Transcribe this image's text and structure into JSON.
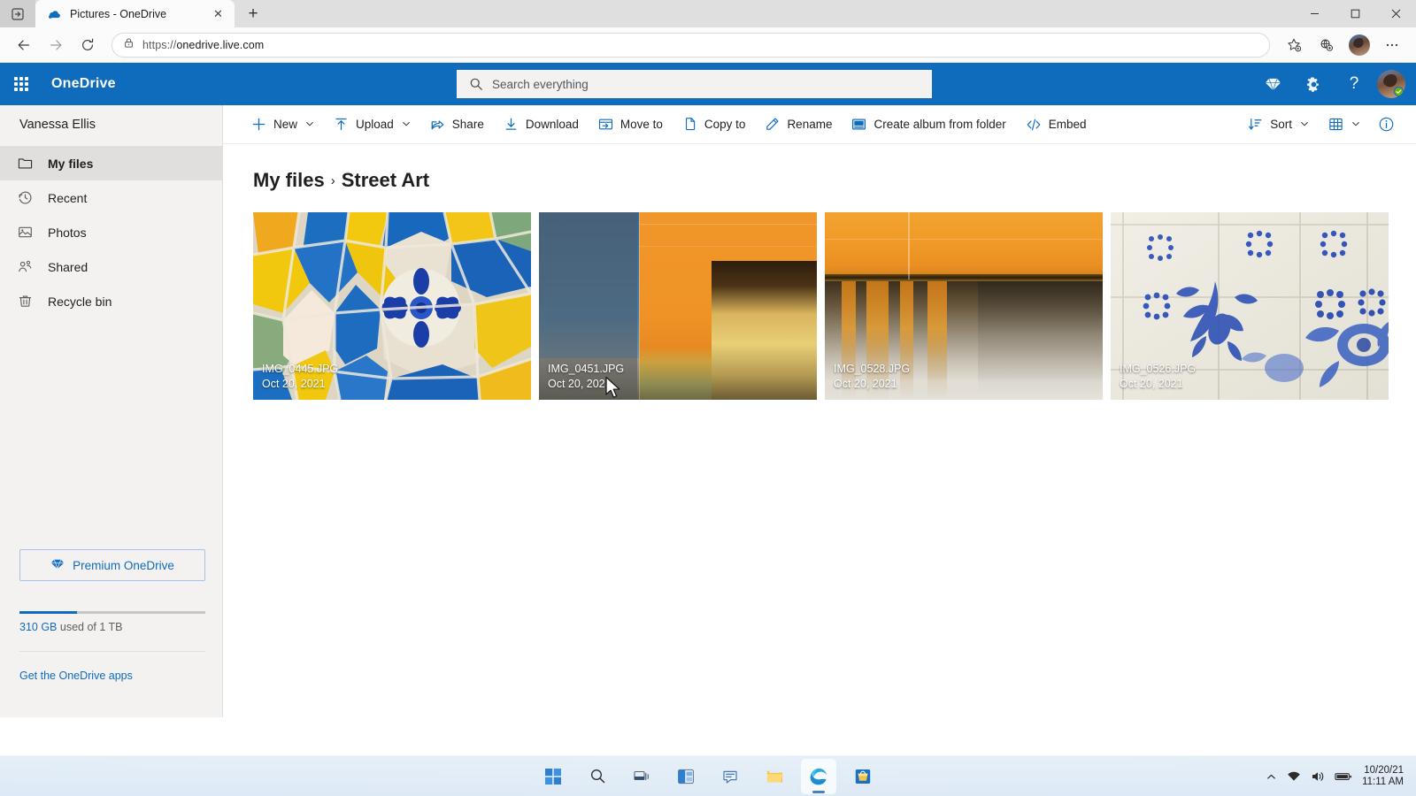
{
  "browser": {
    "tab": {
      "title": "Pictures - OneDrive",
      "favicon": "onedrive-cloud-icon",
      "close_label": "✕"
    },
    "new_tab_label": "+",
    "window_controls": {
      "minimize": "─",
      "maximize": "☐",
      "close": "✕"
    },
    "nav": {
      "back": "←",
      "forward": "→",
      "reload": "↻"
    },
    "address": {
      "scheme": "https://",
      "host": "onedrive.live.com",
      "full": "https://onedrive.live.com",
      "lock_icon": "lock-icon"
    },
    "right_icons": [
      "favorites-star-icon",
      "collections-icon",
      "profile-avatar",
      "settings-more-icon"
    ]
  },
  "suitebar": {
    "waffle_label": "app-launcher",
    "brand": "OneDrive",
    "search": {
      "placeholder": "Search everything",
      "value": ""
    },
    "icons": [
      "premium-diamond-icon",
      "settings-gear-icon",
      "help-question-icon"
    ],
    "help_glyph": "?",
    "avatar_name": "account-avatar"
  },
  "sidebar": {
    "user": "Vanessa Ellis",
    "items": [
      {
        "label": "My files",
        "icon": "folder-icon",
        "active": true
      },
      {
        "label": "Recent",
        "icon": "clock-history-icon",
        "active": false
      },
      {
        "label": "Photos",
        "icon": "photo-icon",
        "active": false
      },
      {
        "label": "Shared",
        "icon": "people-shared-icon",
        "active": false
      },
      {
        "label": "Recycle bin",
        "icon": "trash-bin-icon",
        "active": false
      }
    ],
    "premium_button": "Premium OneDrive",
    "premium_icon": "diamond-icon",
    "quota": {
      "used_text": "310 GB",
      "rest_text": " used of 1 TB",
      "percent": 31
    },
    "apps_link": "Get the OneDrive apps"
  },
  "commandbar": {
    "items": [
      {
        "label": "New",
        "icon": "plus-icon",
        "chevron": true
      },
      {
        "label": "Upload",
        "icon": "upload-arrow-icon",
        "chevron": true
      },
      {
        "label": "Share",
        "icon": "share-icon",
        "chevron": false
      },
      {
        "label": "Download",
        "icon": "download-icon",
        "chevron": false
      },
      {
        "label": "Move to",
        "icon": "move-to-icon",
        "chevron": false
      },
      {
        "label": "Copy to",
        "icon": "copy-icon",
        "chevron": false
      },
      {
        "label": "Rename",
        "icon": "pencil-rename-icon",
        "chevron": false
      },
      {
        "label": "Create album from folder",
        "icon": "album-icon",
        "chevron": false
      },
      {
        "label": "Embed",
        "icon": "code-embed-icon",
        "chevron": false
      }
    ],
    "sort": {
      "label": "Sort",
      "icon": "sort-icon",
      "chevron": true
    },
    "view": {
      "icon": "grid-view-icon",
      "chevron": true
    },
    "info": {
      "icon": "info-icon"
    }
  },
  "content": {
    "breadcrumb": {
      "root": "My files",
      "separator": "›",
      "current": "Street Art"
    },
    "tiles": [
      {
        "name": "IMG_0445.JPG",
        "date": "Oct 20, 2021",
        "art": "mosaic-gaudi",
        "selected": false
      },
      {
        "name": "IMG_0451.JPG",
        "date": "Oct 20, 2021",
        "art": "orange-facade-sky",
        "selected": true
      },
      {
        "name": "IMG_0528.JPG",
        "date": "Oct 20, 2021",
        "art": "orange-glass-building",
        "selected": false
      },
      {
        "name": "IMG_0526.JPG",
        "date": "Oct 20, 2021",
        "art": "azulejo-tiles",
        "selected": false
      }
    ]
  },
  "taskbar": {
    "icons": [
      "start-windows-icon",
      "search-icon",
      "task-view-icon",
      "widgets-icon",
      "chat-teams-icon",
      "file-explorer-icon",
      "edge-browser-icon",
      "microsoft-store-icon"
    ],
    "tray": {
      "overflow": "˄",
      "icons": [
        "wifi-icon",
        "speaker-icon",
        "battery-icon"
      ],
      "date": "10/20/21",
      "time": "11:11 AM"
    }
  }
}
